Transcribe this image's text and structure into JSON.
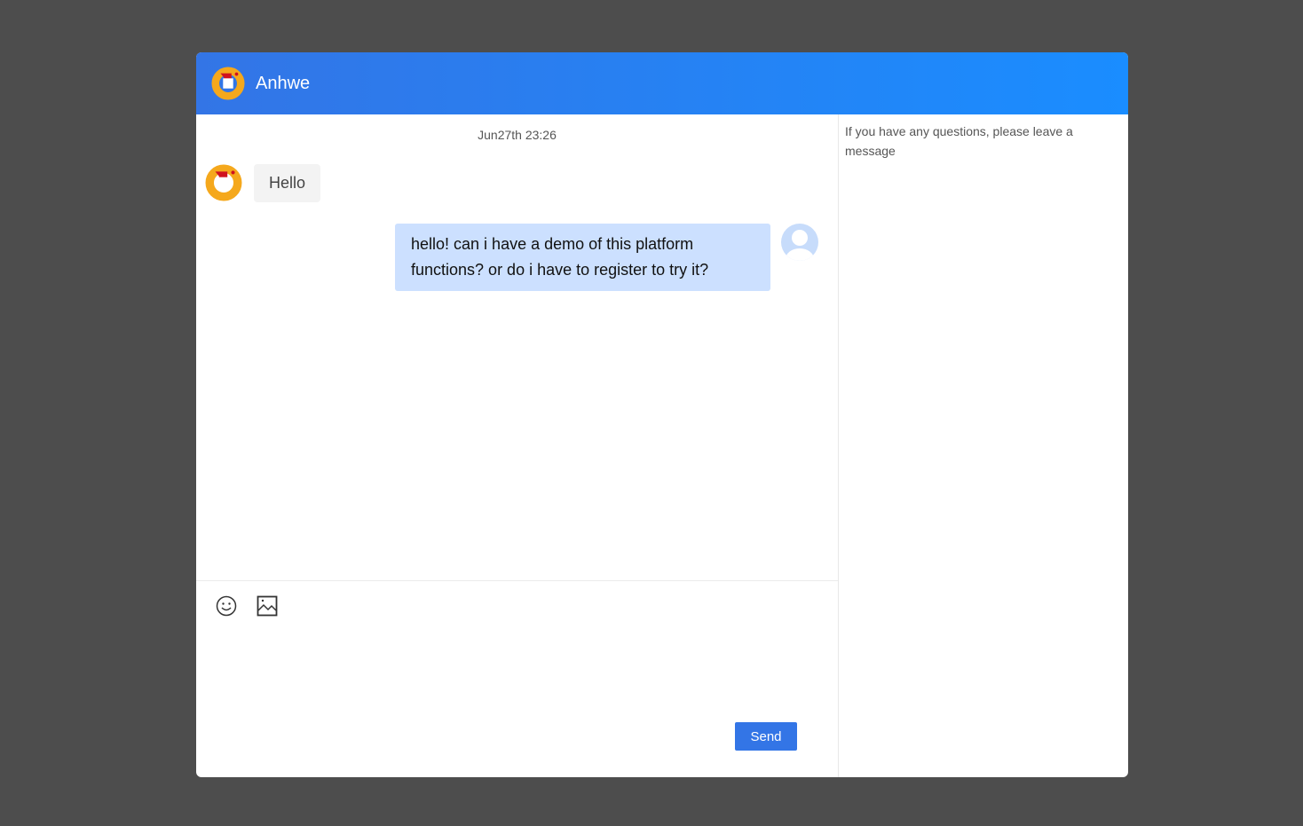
{
  "header": {
    "title": "Anhwe"
  },
  "chat": {
    "timestamp": "Jun27th 23:26",
    "messages": [
      {
        "from": "agent",
        "text": "Hello"
      },
      {
        "from": "user",
        "text": "hello! can i have a demo of this platform functions? or do i have to register to try it?"
      }
    ]
  },
  "composer": {
    "send_label": "Send",
    "icons": [
      "emoji-icon",
      "image-icon"
    ]
  },
  "sidebar": {
    "notice": "If you have any questions, please leave a message"
  }
}
